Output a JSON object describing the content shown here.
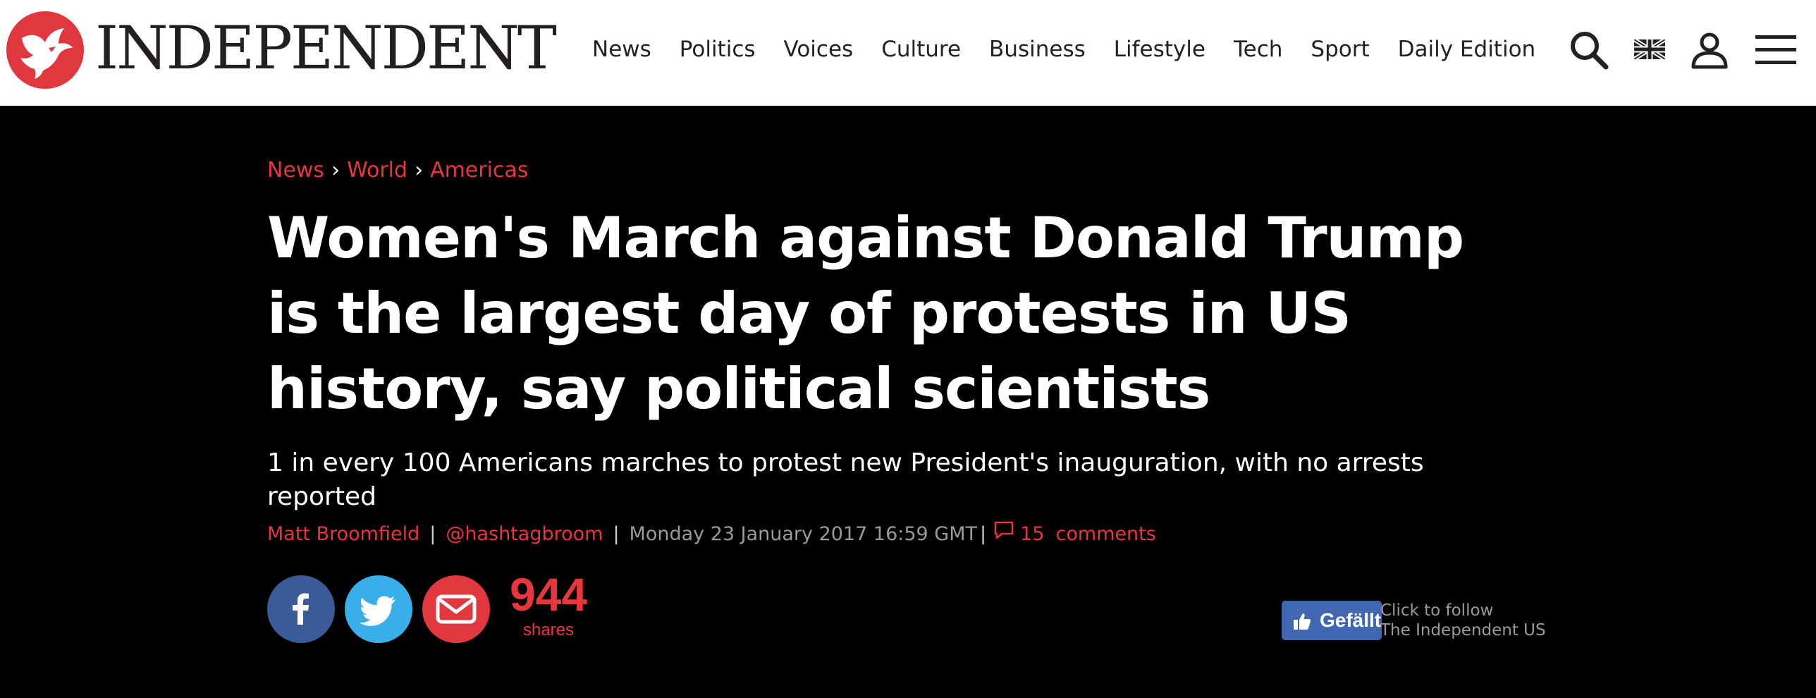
{
  "header": {
    "logo_text": "INDEPENDENT",
    "nav": [
      "News",
      "Politics",
      "Voices",
      "Culture",
      "Business",
      "Lifestyle",
      "Tech",
      "Sport",
      "Daily Edition"
    ],
    "icons": [
      "search-icon",
      "uk-flag-icon",
      "user-icon",
      "menu-icon"
    ]
  },
  "breadcrumb": [
    "News",
    "World",
    "Americas"
  ],
  "article": {
    "headline": "Women's March against Donald Trump is the largest day of protests in US history, say political scientists",
    "standfirst": "1 in every 100 Americans marches to protest new President's inauguration, with no arrests reported",
    "author": "Matt Broomfield",
    "twitter": "@hashtagbroom",
    "date": "Monday 23 January 2017 16:59 GMT",
    "comments_count": "15",
    "comments_label": "comments"
  },
  "share": {
    "count": "944",
    "label": "shares",
    "buttons": [
      "facebook-icon",
      "twitter-icon",
      "email-icon"
    ]
  },
  "like_widget": {
    "button_label": "Gefällt",
    "follow_line1": "Click to follow",
    "follow_line2": "The Independent US"
  },
  "colors": {
    "brand_red": "#e0383e",
    "background": "#000000",
    "facebook": "#3a5a98",
    "twitter": "#3aaee9",
    "like_blue": "#4267b2"
  }
}
